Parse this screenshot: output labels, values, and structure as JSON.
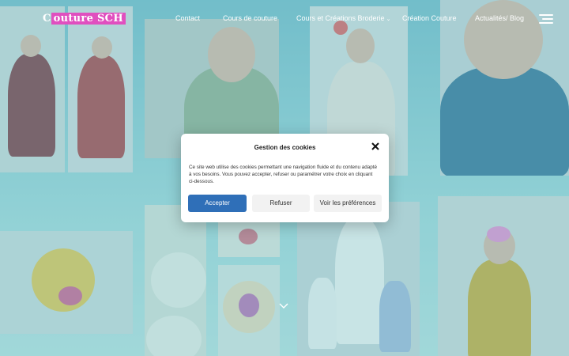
{
  "header": {
    "logo_prefix": "C",
    "logo_highlight": "outure SCH",
    "nav": [
      {
        "label": "Contact"
      },
      {
        "label": "Cours de couture"
      },
      {
        "label": "Cours et Créations Broderie",
        "has_dropdown": true
      },
      {
        "label": "Création Couture"
      },
      {
        "label": "Actualités/ Blog"
      }
    ],
    "menu_icon": "hamburger-icon"
  },
  "cookie_dialog": {
    "title": "Gestion des cookies",
    "close_icon": "close-icon",
    "text": "Ce site web utilise des cookies permettant une navigation fluide et du contenu adapté à vos besoins. Vous pouvez accepter, refuser ou paramétrer votre choix en cliquant ci-dessous.",
    "accept_label": "Accepter",
    "refuse_label": "Refuser",
    "prefs_label": "Voir les préférences"
  },
  "colors": {
    "accent": "#2f6fb8",
    "logo_highlight": "#e04fbf",
    "background_tint": "#8fcfd3"
  }
}
